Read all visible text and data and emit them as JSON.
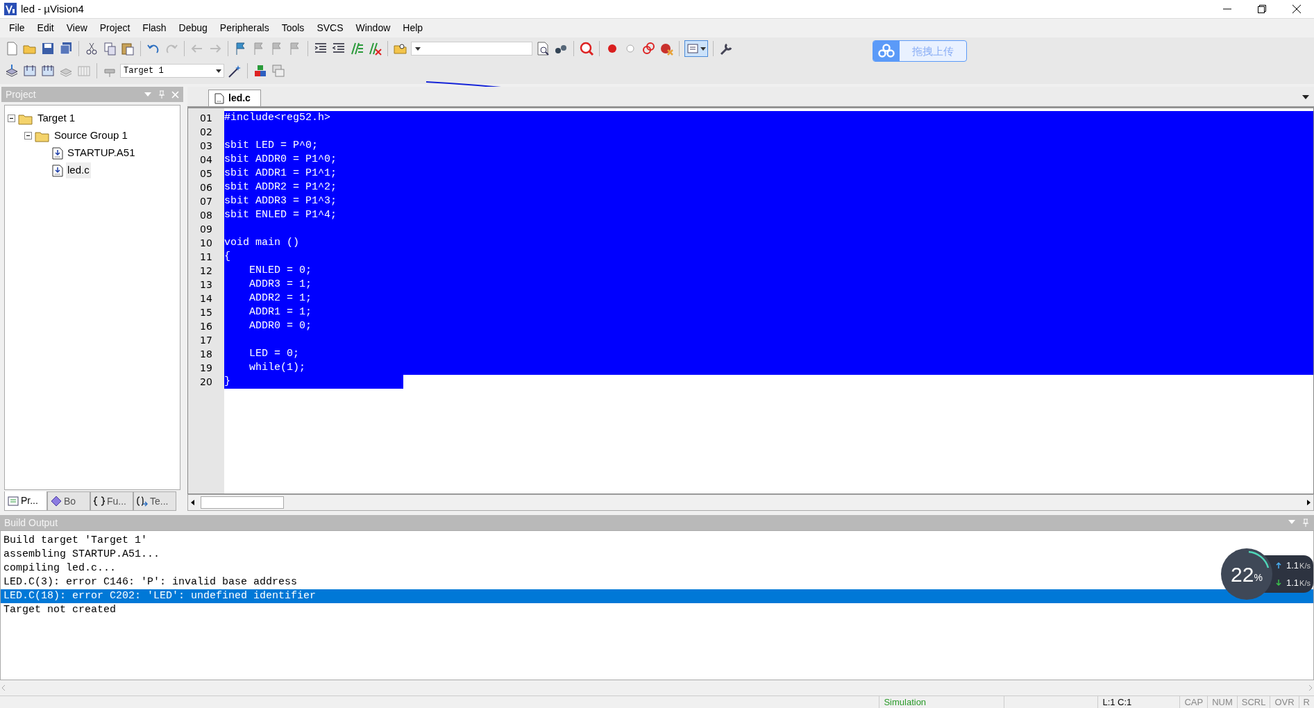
{
  "window": {
    "title": "led  - µVision4"
  },
  "menu": [
    {
      "label": "File"
    },
    {
      "label": "Edit"
    },
    {
      "label": "View"
    },
    {
      "label": "Project"
    },
    {
      "label": "Flash"
    },
    {
      "label": "Debug"
    },
    {
      "label": "Peripherals"
    },
    {
      "label": "Tools"
    },
    {
      "label": "SVCS"
    },
    {
      "label": "Window"
    },
    {
      "label": "Help"
    }
  ],
  "toolbar": {
    "target_select": "Target 1"
  },
  "upload_button": {
    "label": "拖拽上传"
  },
  "project_panel": {
    "title": "Project",
    "tree": [
      {
        "label": "Target 1",
        "expanded": true,
        "selected": false,
        "children": [
          {
            "label": "Source Group 1",
            "expanded": true,
            "selected": false,
            "children": [
              {
                "label": "STARTUP.A51",
                "selected": false
              },
              {
                "label": "led.c",
                "selected": true
              }
            ]
          }
        ]
      }
    ],
    "tabs": [
      {
        "label": "Pr...",
        "selected": true
      },
      {
        "label": "Bo",
        "selected": false
      },
      {
        "label": "Fu...",
        "selected": false
      },
      {
        "label": "Te...",
        "selected": false
      }
    ]
  },
  "editor": {
    "tabs": [
      {
        "label": "led.c",
        "selected": true
      }
    ],
    "lines": [
      {
        "number": "01",
        "text": "#include<reg52.h>",
        "selected": true,
        "kind": "full"
      },
      {
        "number": "02",
        "selected": true,
        "kind": "full"
      },
      {
        "number": "03",
        "text": "sbit LED = P^0;",
        "selected": true,
        "kind": "full"
      },
      {
        "number": "04",
        "text": "sbit ADDR0 = P1^0;",
        "selected": true,
        "kind": "full"
      },
      {
        "number": "05",
        "text": "sbit ADDR1 = P1^1;",
        "selected": true,
        "kind": "full"
      },
      {
        "number": "06",
        "text": "sbit ADDR2 = P1^2;",
        "selected": true,
        "kind": "full"
      },
      {
        "number": "07",
        "text": "sbit ADDR3 = P1^3;",
        "selected": true,
        "kind": "full"
      },
      {
        "number": "08",
        "text": "sbit ENLED = P1^4;",
        "selected": true,
        "kind": "full"
      },
      {
        "number": "09",
        "selected": true,
        "kind": "full"
      },
      {
        "number": "10",
        "text": "void main ()",
        "selected": true,
        "kind": "full"
      },
      {
        "number": "11",
        "text": "{",
        "selected": true,
        "kind": "full"
      },
      {
        "number": "12",
        "text": "    ENLED = 0;",
        "selected": true,
        "kind": "full"
      },
      {
        "number": "13",
        "text": "    ADDR3 = 1;",
        "selected": true,
        "kind": "full"
      },
      {
        "number": "14",
        "text": "    ADDR2 = 1;",
        "selected": true,
        "kind": "full"
      },
      {
        "number": "15",
        "text": "    ADDR1 = 1;",
        "selected": true,
        "kind": "full"
      },
      {
        "number": "16",
        "text": "    ADDR0 = 0;",
        "selected": true,
        "kind": "full"
      },
      {
        "number": "17",
        "selected": true,
        "kind": "full"
      },
      {
        "number": "18",
        "text": "    LED = 0;",
        "selected": true,
        "kind": "full"
      },
      {
        "number": "19",
        "text": "    while(1);",
        "selected": true,
        "kind": "full"
      },
      {
        "number": "20",
        "text": "}",
        "selected": true,
        "kind": "end"
      }
    ]
  },
  "build_output": {
    "title": "Build Output",
    "lines": [
      {
        "text": "Build target 'Target 1'",
        "selected": false
      },
      {
        "text": "assembling STARTUP.A51...",
        "selected": false
      },
      {
        "text": "compiling led.c...",
        "selected": false
      },
      {
        "text": "LED.C(3): error C146: 'P': invalid base address",
        "selected": false
      },
      {
        "text": "LED.C(18): error C202: 'LED': undefined identifier",
        "selected": true
      },
      {
        "text": "Target not created",
        "selected": false
      }
    ]
  },
  "net_monitor": {
    "percent": "22",
    "percent_unit": "%",
    "upload": "1.1",
    "upload_unit": "K/s",
    "download": "1.1",
    "download_unit": "K/s"
  },
  "status_bar": {
    "mode": "Simulation",
    "position": "L:1 C:1",
    "indicators": [
      "CAP",
      "NUM",
      "SCRL",
      "OVR",
      "R"
    ]
  }
}
